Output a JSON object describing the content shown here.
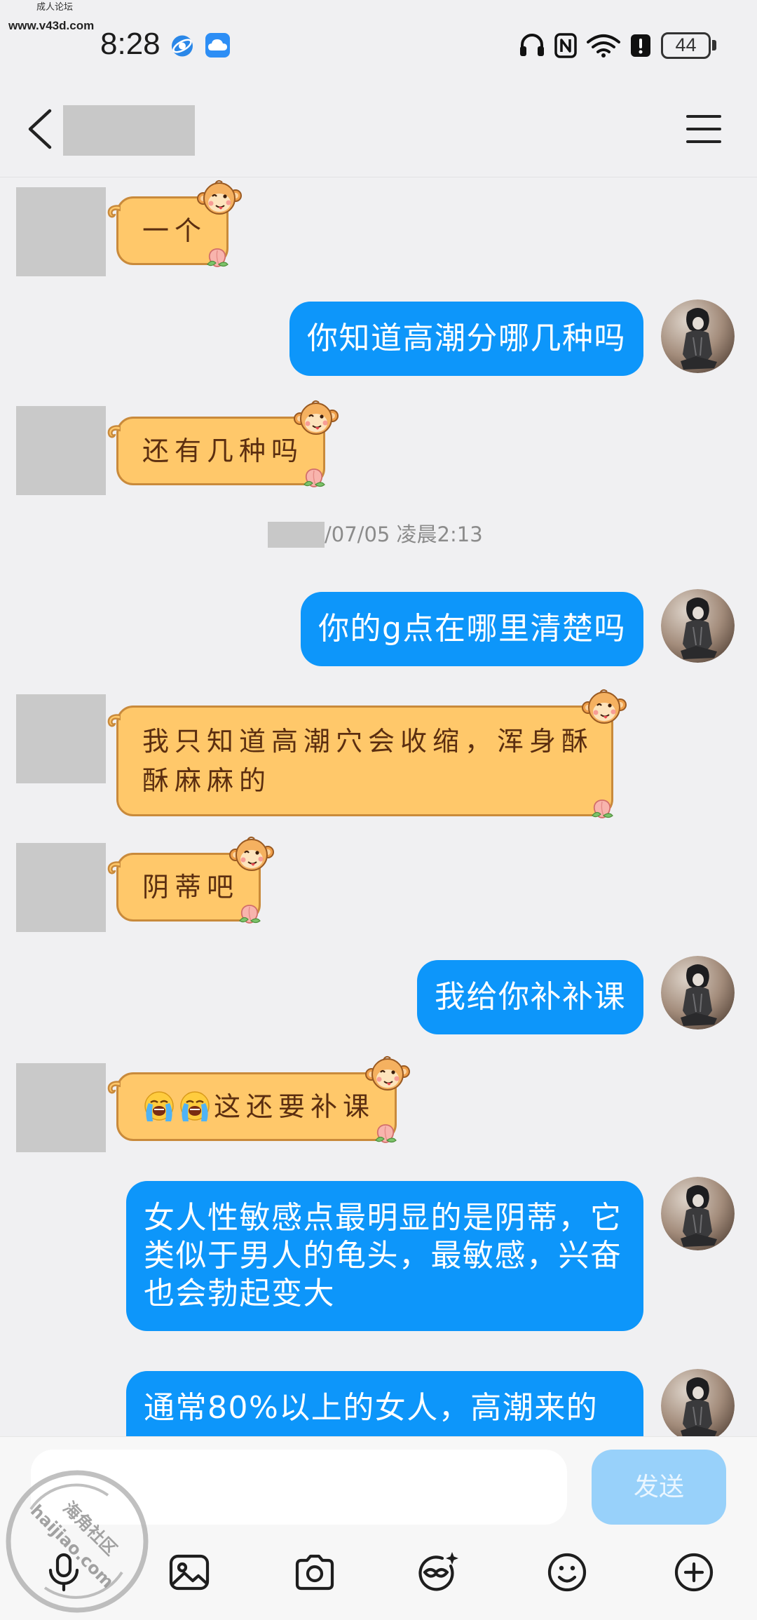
{
  "top_watermark": {
    "title": "成人论坛",
    "url": "www.v43d.com"
  },
  "status_bar": {
    "time": "8:28",
    "left_icons": [
      "browser-app-icon",
      "cloud-app-icon"
    ],
    "right_icons": [
      "headphones-icon",
      "nfc-icon",
      "wifi-icon",
      "alert-icon"
    ],
    "battery_level": "44"
  },
  "header": {
    "back_icon": "chevron-left-icon",
    "menu_icon": "menu-icon"
  },
  "conversation": [
    {
      "type": "message",
      "sender": "contact",
      "text": "一个"
    },
    {
      "type": "message",
      "sender": "me",
      "text": "你知道高潮分哪几种吗"
    },
    {
      "type": "message",
      "sender": "contact",
      "text": "还有几种吗"
    },
    {
      "type": "timestamp",
      "text": "/07/05 凌晨2:13"
    },
    {
      "type": "message",
      "sender": "me",
      "text": "你的g点在哪里清楚吗"
    },
    {
      "type": "message",
      "sender": "contact",
      "text": "我只知道高潮穴会收缩，浑身酥酥麻麻的"
    },
    {
      "type": "message",
      "sender": "contact",
      "text": "阴蒂吧"
    },
    {
      "type": "message",
      "sender": "me",
      "text": "我给你补补课"
    },
    {
      "type": "message",
      "sender": "contact",
      "emoji": [
        "loudly-crying-face",
        "loudly-crying-face"
      ],
      "text": "这还要补课"
    },
    {
      "type": "message",
      "sender": "me",
      "text": "女人性敏感点最明显的是阴蒂，它类似于男人的龟头，最敏感，兴奋也会勃起变大"
    },
    {
      "type": "message",
      "sender": "me",
      "text": "通常80%以上的女人，高潮来的"
    }
  ],
  "input_bar": {
    "text_value": "",
    "send_label": "发送"
  },
  "toolbar": {
    "icons": [
      "microphone-icon",
      "image-icon",
      "camera-icon",
      "sticker-icon",
      "emoji-icon",
      "plus-icon"
    ]
  },
  "bottom_watermark": {
    "name": "海角社区",
    "url": "haijiao.com"
  },
  "colors": {
    "background": "#f0f0f2",
    "outgoing_bubble": "#0d96fa",
    "incoming_bubble": "#ffc86a",
    "incoming_bubble_border": "#c98a3b",
    "send_button": "#98d1fa"
  }
}
